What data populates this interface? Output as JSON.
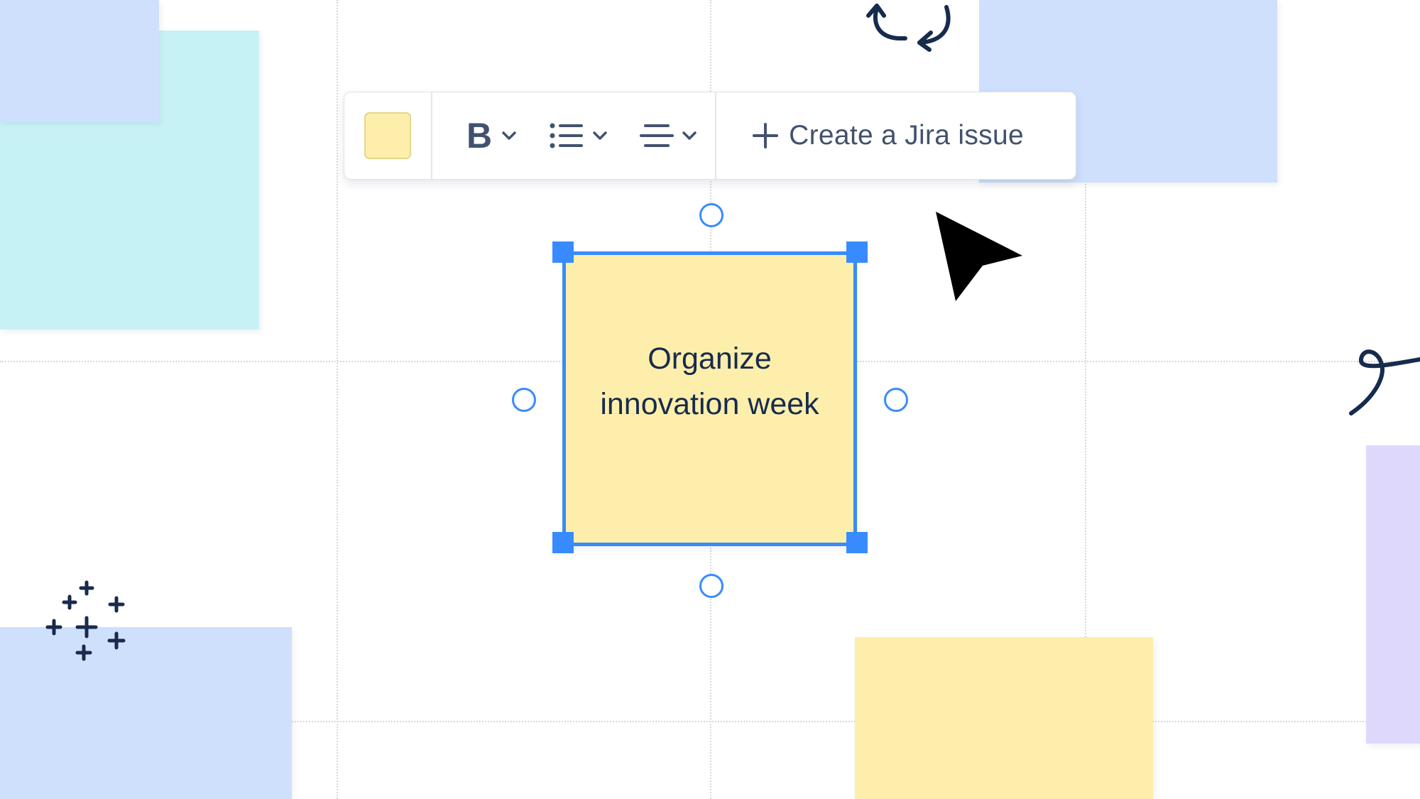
{
  "toolbar": {
    "color_swatch": "#fdeeab",
    "bold_label": "B",
    "jira_label": "Create a Jira issue",
    "icons": [
      "chevron-down-icon",
      "bullet-list-icon",
      "text-align-center-icon",
      "plus-icon"
    ]
  },
  "selected_note": {
    "text": "Organize innovation week",
    "color": "#fdeeab",
    "selection_color": "#388bff"
  },
  "notes": [
    {
      "name": "blue-note-top-left",
      "color": "#cfe0fd"
    },
    {
      "name": "teal-note-left",
      "color": "#c7f2f5"
    },
    {
      "name": "blue-note-top-right",
      "color": "#cfe0fd"
    },
    {
      "name": "blue-note-bottom-left",
      "color": "#cfe0fd"
    },
    {
      "name": "yellow-note-bottom",
      "color": "#fdeeab"
    },
    {
      "name": "purple-note-right",
      "color": "#dfd8fd"
    }
  ],
  "doodles": [
    "rotate-arrows-doodle",
    "sparkle-plus-doodle",
    "loop-squiggle-doodle"
  ]
}
